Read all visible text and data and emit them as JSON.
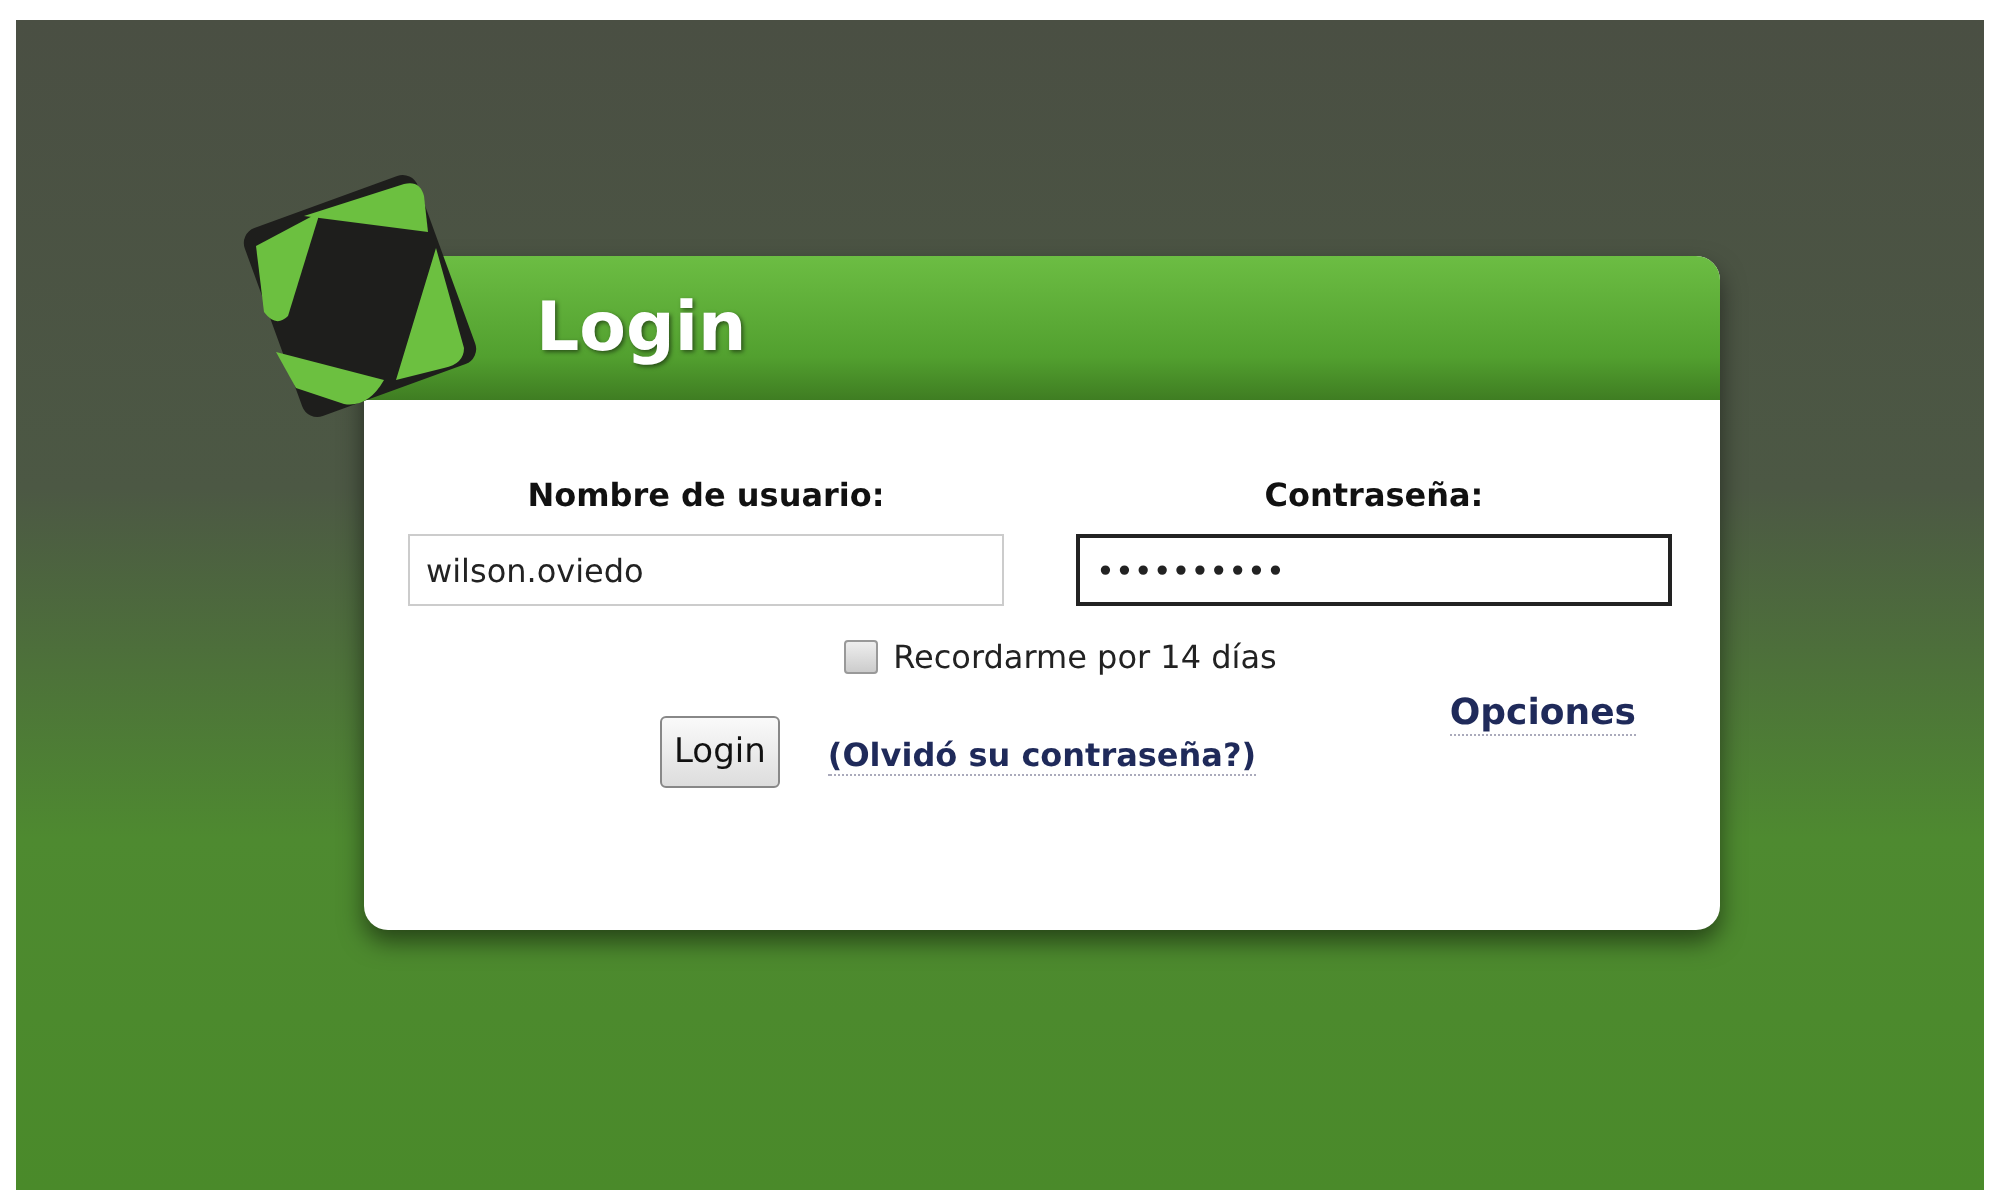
{
  "dialog": {
    "title": "Login"
  },
  "fields": [
    {
      "label": "Nombre de usuario:",
      "value": "wilson.oviedo",
      "focused": false
    },
    {
      "label": "Contraseña:",
      "value": "••••••••••",
      "focused": true
    }
  ],
  "remember": {
    "label": "Recordarme por 14 días",
    "checked": false
  },
  "options_link": "Opciones",
  "login_button": "Login",
  "forgot_link": "(Olvidó su contraseña?)"
}
